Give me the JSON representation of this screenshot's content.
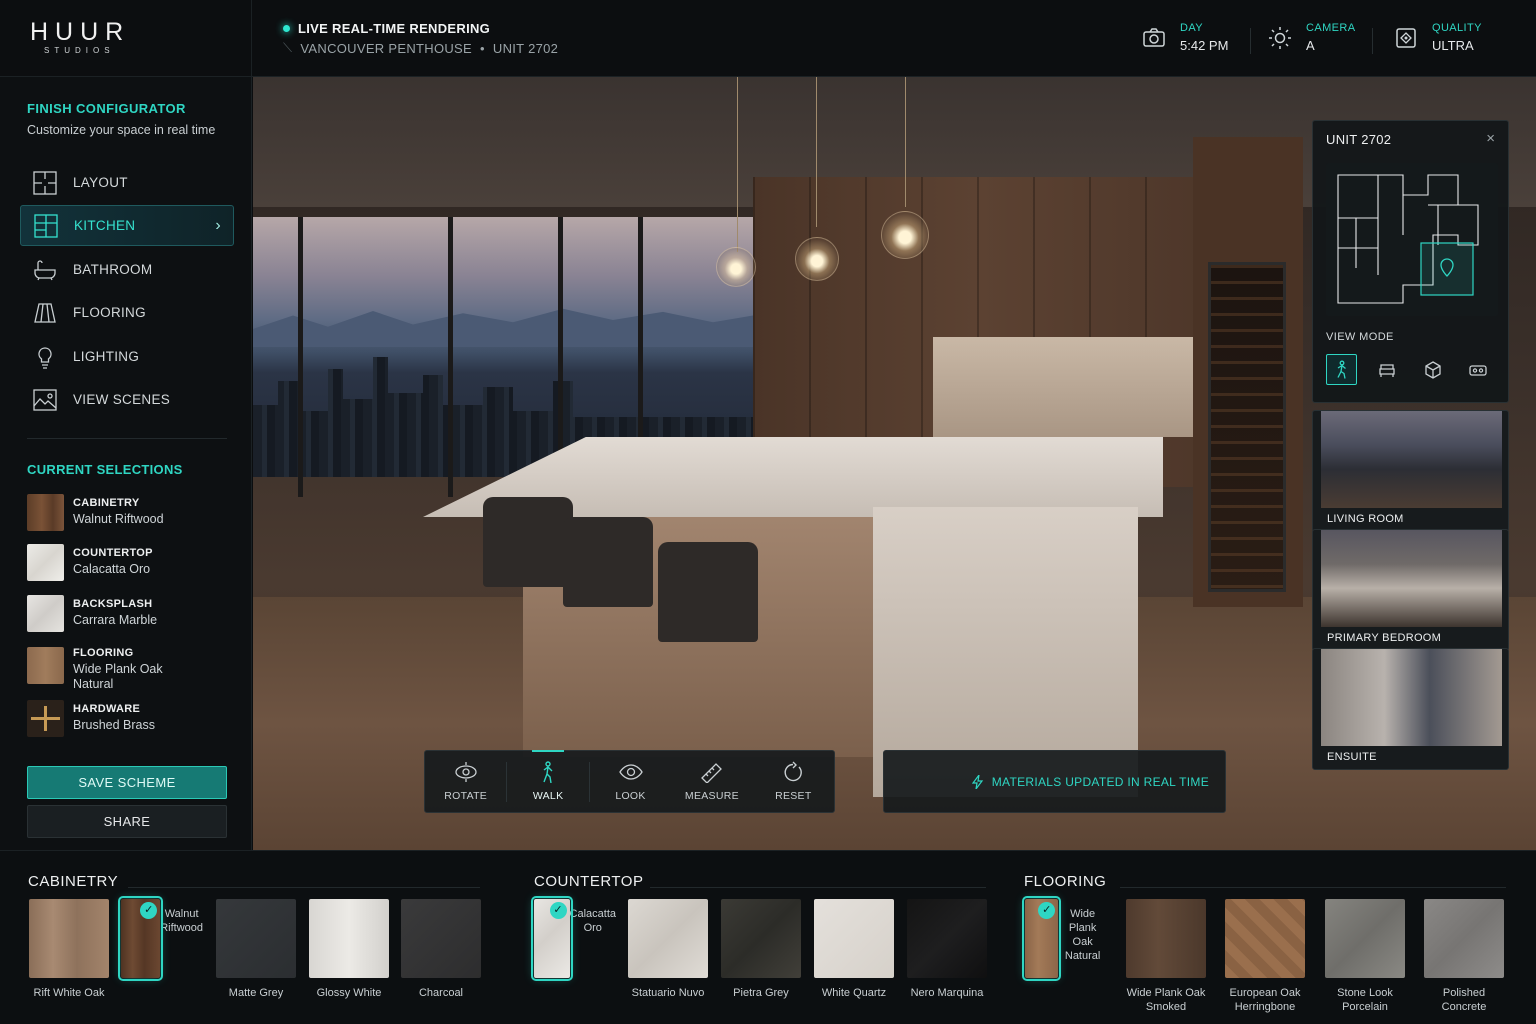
{
  "brand": {
    "name": "HUUR",
    "sub": "STUDIOS"
  },
  "header": {
    "live_label": "LIVE REAL-TIME RENDERING",
    "location": "VANCOUVER PENTHOUSE",
    "unit": "UNIT 2702",
    "separator": "•",
    "stats": [
      {
        "label": "DAY",
        "value": "5:42 PM",
        "icon": "camera-icon"
      },
      {
        "label": "CAMERA",
        "value": "A",
        "icon": "sun-icon"
      },
      {
        "label": "QUALITY",
        "value": "ULTRA",
        "icon": "quality-icon"
      }
    ]
  },
  "sidebar": {
    "title": "FINISH CONFIGURATOR",
    "subtitle": "Customize your space in real time",
    "nav": [
      {
        "label": "LAYOUT",
        "icon": "layout-icon"
      },
      {
        "label": "KITCHEN",
        "icon": "kitchen-icon",
        "active": true
      },
      {
        "label": "BATHROOM",
        "icon": "bathtub-icon"
      },
      {
        "label": "FLOORING",
        "icon": "flooring-icon"
      },
      {
        "label": "LIGHTING",
        "icon": "lightbulb-icon"
      },
      {
        "label": "VIEW SCENES",
        "icon": "image-icon"
      }
    ],
    "selections_title": "CURRENT SELECTIONS",
    "selections": [
      {
        "category": "CABINETRY",
        "value": "Walnut Riftwood"
      },
      {
        "category": "COUNTERTOP",
        "value": "Calacatta Oro"
      },
      {
        "category": "BACKSPLASH",
        "value": "Carrara Marble"
      },
      {
        "category": "FLOORING",
        "value": "Wide Plank Oak Natural"
      },
      {
        "category": "HARDWARE",
        "value": "Brushed Brass"
      }
    ],
    "save_label": "SAVE SCHEME",
    "share_label": "SHARE"
  },
  "viewport": {
    "tools": [
      {
        "label": "ROTATE",
        "icon": "rotate-icon"
      },
      {
        "label": "WALK",
        "icon": "walk-icon",
        "active": true
      },
      {
        "label": "LOOK",
        "icon": "eye-icon"
      },
      {
        "label": "MEASURE",
        "icon": "ruler-icon"
      },
      {
        "label": "RESET",
        "icon": "reset-icon"
      }
    ],
    "status": "MATERIALS UPDATED IN REAL TIME"
  },
  "minipanel": {
    "title": "UNIT 2702",
    "close": "×",
    "view_mode_label": "VIEW MODE",
    "view_modes": [
      "walk-mode-icon",
      "seat-mode-icon",
      "cube-mode-icon",
      "vr-mode-icon"
    ]
  },
  "scenes": [
    {
      "label": "LIVING ROOM"
    },
    {
      "label": "PRIMARY BEDROOM"
    },
    {
      "label": "ENSUITE"
    }
  ],
  "palette": {
    "cabinetry": {
      "title": "CABINETRY",
      "items": [
        {
          "name": "Rift White Oak"
        },
        {
          "name": "Walnut Riftwood",
          "selected": true
        },
        {
          "name": "Matte Grey"
        },
        {
          "name": "Glossy White"
        },
        {
          "name": "Charcoal"
        }
      ]
    },
    "countertop": {
      "title": "COUNTERTOP",
      "items": [
        {
          "name": "Calacatta Oro",
          "selected": true
        },
        {
          "name": "Statuario Nuvo"
        },
        {
          "name": "Pietra Grey"
        },
        {
          "name": "White Quartz"
        },
        {
          "name": "Nero Marquina"
        }
      ]
    },
    "flooring": {
      "title": "FLOORING",
      "items": [
        {
          "name": "Wide Plank Oak Natural",
          "selected": true
        },
        {
          "name": "Wide Plank Oak Smoked"
        },
        {
          "name": "European Oak Herringbone"
        },
        {
          "name": "Stone Look Porcelain"
        },
        {
          "name": "Polished Concrete"
        }
      ]
    }
  },
  "colors": {
    "accent": "#2fd6c3",
    "panel": "#0d1012"
  }
}
